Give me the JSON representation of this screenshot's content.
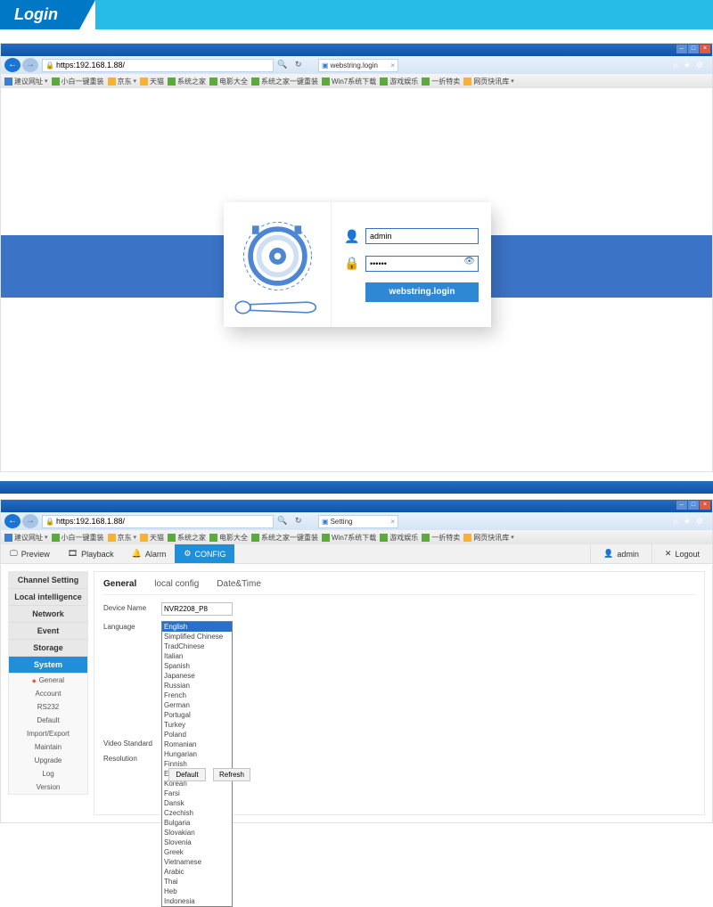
{
  "header": {
    "title": "Login"
  },
  "browser": {
    "url": "https:192.168.1.88/",
    "tab1_label": "webstring.login",
    "tab2_label": "Setting",
    "bookmarks": [
      "建议网址",
      "小白一键重装",
      "京东",
      "天猫",
      "系统之家",
      "电影大全",
      "系统之家一键重装",
      "Win7系统下载",
      "游戏娱乐",
      "一折特卖",
      "网页快讯库"
    ]
  },
  "login": {
    "user_value": "admin",
    "pass_value": "••••••",
    "button_label": "webstring.login"
  },
  "toolbar": {
    "preview": "Preview",
    "playback": "Playback",
    "alarm": "Alarm",
    "config": "CONFIG",
    "user": "admin",
    "logout": "Logout"
  },
  "sidebar": {
    "sections": [
      "Channel Setting",
      "Local intelligence",
      "Network",
      "Event",
      "Storage",
      "System"
    ],
    "system_items": [
      "General",
      "Account",
      "RS232",
      "Default",
      "Import/Export",
      "Maintain",
      "Upgrade",
      "Log",
      "Version"
    ]
  },
  "tabs": {
    "t0": "General",
    "t1": "local config",
    "t2": "Date&Time"
  },
  "form": {
    "device_name_label": "Device Name",
    "device_name_value": "NVR2208_P8",
    "language_label": "Language",
    "video_std_label": "Video Standard",
    "resolution_label": "Resolution",
    "default_btn": "Default",
    "refresh_btn": "Refresh",
    "languages": [
      "English",
      "Simplified Chinese",
      "TradChinese",
      "Italian",
      "Spanish",
      "Japanese",
      "Russian",
      "French",
      "German",
      "Portugal",
      "Turkey",
      "Poland",
      "Romanian",
      "Hungarian",
      "Finnish",
      "Estonian",
      "Korean",
      "Farsi",
      "Dansk",
      "Czechish",
      "Bulgaria",
      "Slovakian",
      "Slovenia",
      "Greek",
      "Vietnamese",
      "Arabic",
      "Thai",
      "Heb",
      "Indonesia"
    ]
  }
}
